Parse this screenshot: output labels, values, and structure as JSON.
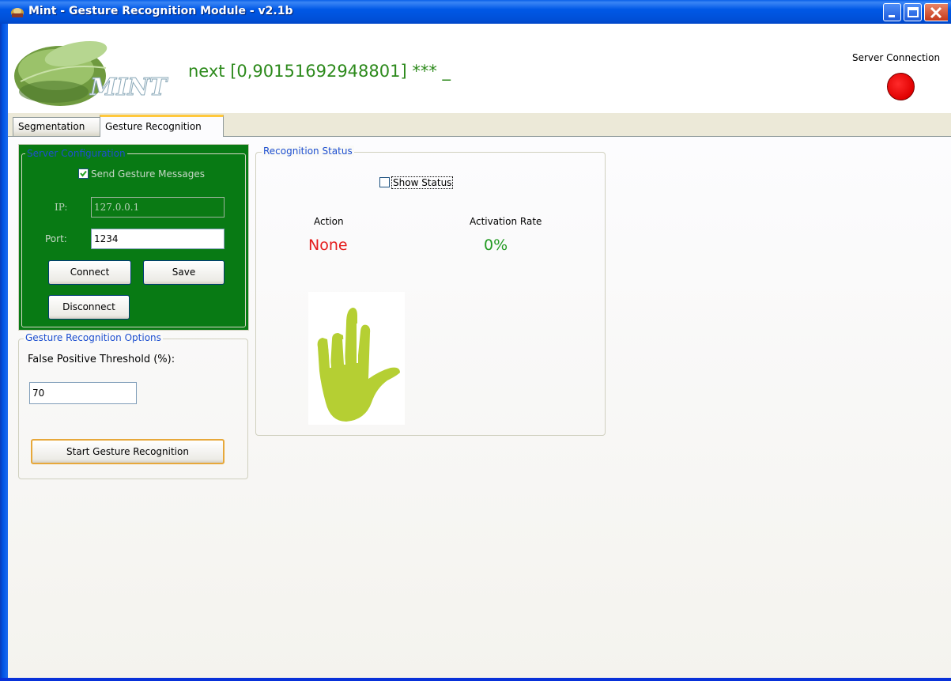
{
  "window": {
    "title": "Mint - Gesture Recognition Module - v2.1b"
  },
  "header": {
    "logo_text": "MINT",
    "status_line": "next [0,90151692948801] *** _",
    "server_connection_label": "Server Connection",
    "server_connection_status_color": "#E00000"
  },
  "tabs": [
    {
      "label": "Segmentation",
      "active": false
    },
    {
      "label": "Gesture Recognition",
      "active": true
    }
  ],
  "server_config": {
    "legend": "Server Configuration",
    "send_messages_label": "Send Gesture Messages",
    "send_messages_checked": true,
    "ip_label": "IP:",
    "ip_value": "127.0.0.1",
    "port_label": "Port:",
    "port_value": "1234",
    "connect_label": "Connect",
    "save_label": "Save",
    "disconnect_label": "Disconnect",
    "panel_color": "#087A14"
  },
  "options": {
    "legend": "Gesture Recognition Options",
    "threshold_label": "False Positive Threshold (%):",
    "threshold_value": "70",
    "start_label": "Start Gesture Recognition"
  },
  "status": {
    "legend": "Recognition Status",
    "show_status_label": "Show Status",
    "show_status_checked": false,
    "action_header": "Action",
    "action_value": "None",
    "action_color": "#E41B1B",
    "rate_header": "Activation Rate",
    "rate_value": "0%",
    "rate_color": "#229A22",
    "gesture_icon": "open-hand-icon",
    "hand_color": "#B5CF33"
  }
}
